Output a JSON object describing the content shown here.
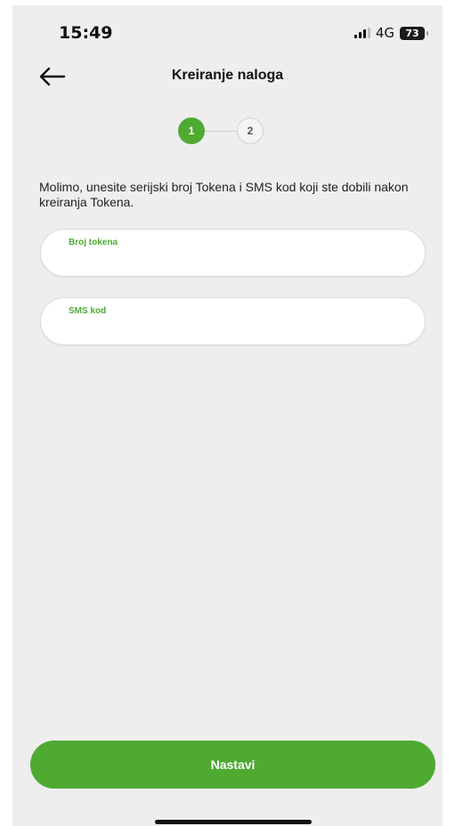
{
  "status_bar": {
    "time": "15:49",
    "network": "4G",
    "battery": "73",
    "signal_icon": "signal-bars-icon"
  },
  "header": {
    "title": "Kreiranje naloga",
    "back_icon": "arrow-left-icon"
  },
  "stepper": {
    "steps": [
      "1",
      "2"
    ],
    "active_step": 1
  },
  "instruction": "Molimo, unesite serijski broj Tokena i SMS kod koji ste dobili nakon kreiranja Tokena.",
  "fields": {
    "token": {
      "label": "Broj tokena",
      "value": ""
    },
    "sms": {
      "label": "SMS kod",
      "value": ""
    }
  },
  "button": {
    "label": "Nastavi"
  },
  "colors": {
    "accent": "#4faa32",
    "background": "#eeeeee",
    "field_bg": "#ffffff"
  }
}
